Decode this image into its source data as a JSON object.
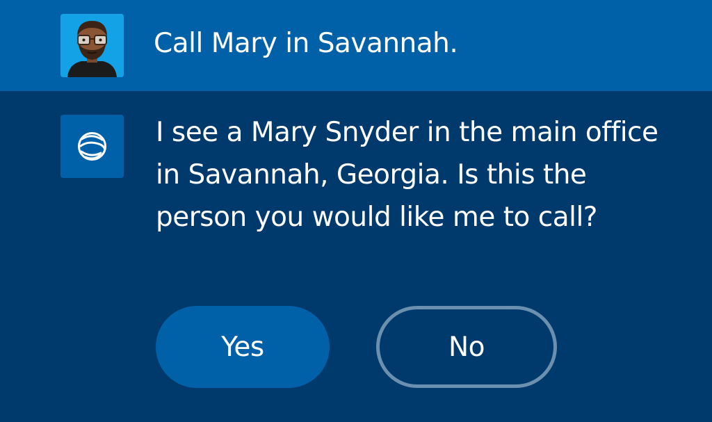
{
  "user_message": {
    "avatar_icon": "user-avatar",
    "text": "Call Mary in Savannah."
  },
  "assistant_message": {
    "logo_icon": "assistant-swirl-icon",
    "text": "I see a Mary Snyder in the main office in Savannah, Georgia. Is this the person you would like me to call?"
  },
  "actions": {
    "yes_label": "Yes",
    "no_label": "No"
  },
  "colors": {
    "background": "#003a6c",
    "user_row": "#0061a9",
    "button_primary": "#0061a9",
    "button_outline": "#6b8fae",
    "avatar_bg": "#13a2e6"
  }
}
